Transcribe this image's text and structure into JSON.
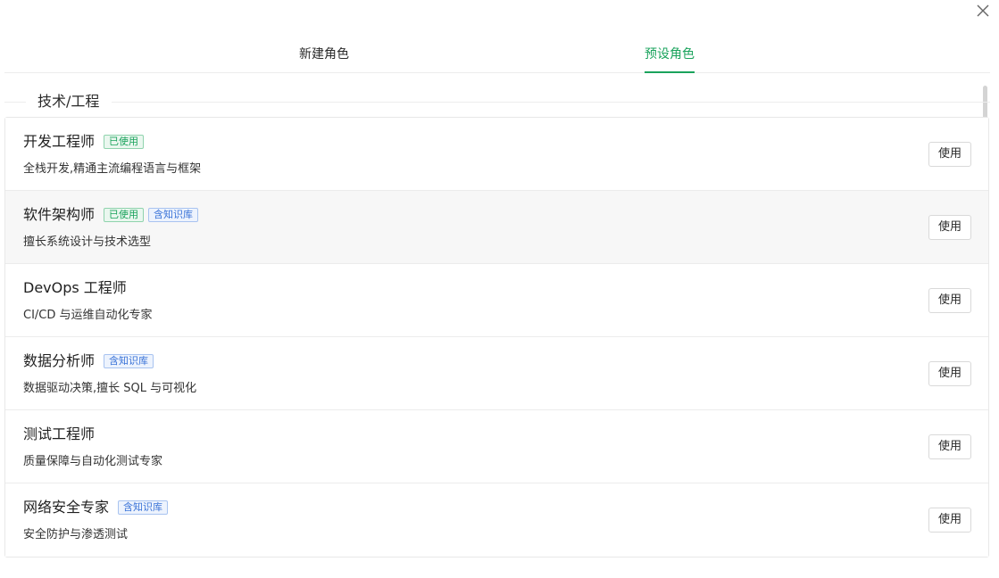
{
  "tabs": {
    "new_role": "新建角色",
    "preset_role": "预设角色",
    "active": "preset_role"
  },
  "section": {
    "title": "技术/工程"
  },
  "roles": [
    {
      "name": "开发工程师",
      "badges": [
        "已使用"
      ],
      "description": "全栈开发,精通主流编程语言与框架",
      "button": "使用"
    },
    {
      "name": "软件架构师",
      "badges": [
        "已使用",
        "含知识库"
      ],
      "description": "擅长系统设计与技术选型",
      "button": "使用"
    },
    {
      "name": "DevOps 工程师",
      "badges": [],
      "description": "CI/CD 与运维自动化专家",
      "button": "使用"
    },
    {
      "name": "数据分析师",
      "badges": [
        "含知识库"
      ],
      "description": "数据驱动决策,擅长 SQL 与可视化",
      "button": "使用"
    },
    {
      "name": "测试工程师",
      "badges": [],
      "description": "质量保障与自动化测试专家",
      "button": "使用"
    },
    {
      "name": "网络安全专家",
      "badges": [
        "含知识库"
      ],
      "description": "安全防护与渗透测试",
      "button": "使用"
    }
  ],
  "colors": {
    "accent": "#1aa35c",
    "badge_used": "#1aa35c",
    "badge_kb": "#3a73d8"
  },
  "icons": {
    "close": "close-icon"
  }
}
